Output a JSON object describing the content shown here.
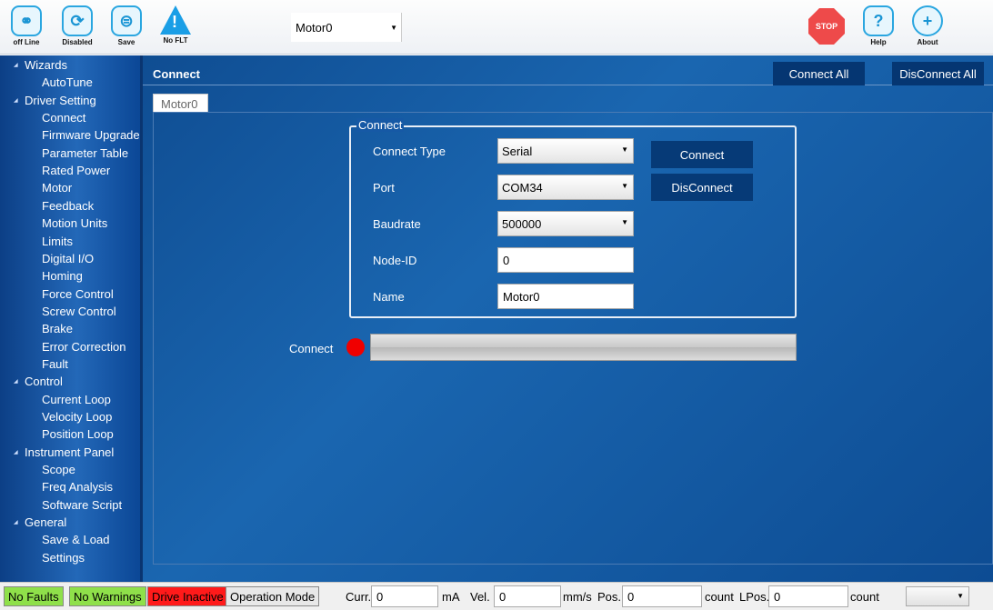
{
  "toolbar": {
    "offline_label": "off Line",
    "disabled_label": "Disabled",
    "save_label": "Save",
    "noflt_label": "No FLT",
    "motor_select_value": "Motor0",
    "stop_label": "STOP",
    "help_label": "Help",
    "about_label": "About"
  },
  "sidebar": {
    "items": [
      {
        "label": "Wizards",
        "level": 0
      },
      {
        "label": "AutoTune",
        "level": 1
      },
      {
        "label": "Driver Setting",
        "level": 0
      },
      {
        "label": "Connect",
        "level": 1
      },
      {
        "label": "Firmware Upgrade",
        "level": 1
      },
      {
        "label": "Parameter Table",
        "level": 1
      },
      {
        "label": "Rated Power",
        "level": 1
      },
      {
        "label": "Motor",
        "level": 1
      },
      {
        "label": "Feedback",
        "level": 1
      },
      {
        "label": "Motion Units",
        "level": 1
      },
      {
        "label": "Limits",
        "level": 1
      },
      {
        "label": "Digital I/O",
        "level": 1
      },
      {
        "label": "Homing",
        "level": 1
      },
      {
        "label": "Force Control",
        "level": 1
      },
      {
        "label": "Screw Control",
        "level": 1
      },
      {
        "label": "Brake",
        "level": 1
      },
      {
        "label": "Error Correction",
        "level": 1
      },
      {
        "label": "Fault",
        "level": 1
      },
      {
        "label": "Control",
        "level": 0
      },
      {
        "label": "Current Loop",
        "level": 1
      },
      {
        "label": "Velocity Loop",
        "level": 1
      },
      {
        "label": "Position Loop",
        "level": 1
      },
      {
        "label": "Instrument Panel",
        "level": 0
      },
      {
        "label": "Scope",
        "level": 1
      },
      {
        "label": "Freq Analysis",
        "level": 1
      },
      {
        "label": "Software Script",
        "level": 1
      },
      {
        "label": "General",
        "level": 0
      },
      {
        "label": "Save & Load",
        "level": 1
      },
      {
        "label": "Settings",
        "level": 1
      }
    ]
  },
  "main": {
    "title": "Connect",
    "connect_all_label": "Connect All",
    "disconnect_all_label": "DisConnect All",
    "tab_label": "Motor0",
    "group_title": "Connect",
    "fields": {
      "connect_type_label": "Connect Type",
      "connect_type_value": "Serial",
      "port_label": "Port",
      "port_value": "COM34",
      "baudrate_label": "Baudrate",
      "baudrate_value": "500000",
      "node_id_label": "Node-ID",
      "node_id_value": "0",
      "name_label": "Name",
      "name_value": "Motor0"
    },
    "connect_button": "Connect",
    "disconnect_button": "DisConnect",
    "status_label": "Connect",
    "status_color": "#f00000"
  },
  "statusbar": {
    "no_faults": "No Faults",
    "no_warnings": "No Warnings",
    "drive_inactive": "Drive Inactive",
    "operation_mode": "Operation Mode",
    "curr_label": "Curr.",
    "curr_value": "0",
    "curr_unit": "mA",
    "vel_label": "Vel.",
    "vel_value": "0",
    "vel_unit": "mm/s",
    "pos_label": "Pos.",
    "pos_value": "0",
    "pos_unit": "count",
    "lpos_label": "LPos.",
    "lpos_value": "0",
    "lpos_unit": "count",
    "colors": {
      "ok": "#8fe04a",
      "error": "#ff1a1a"
    }
  }
}
